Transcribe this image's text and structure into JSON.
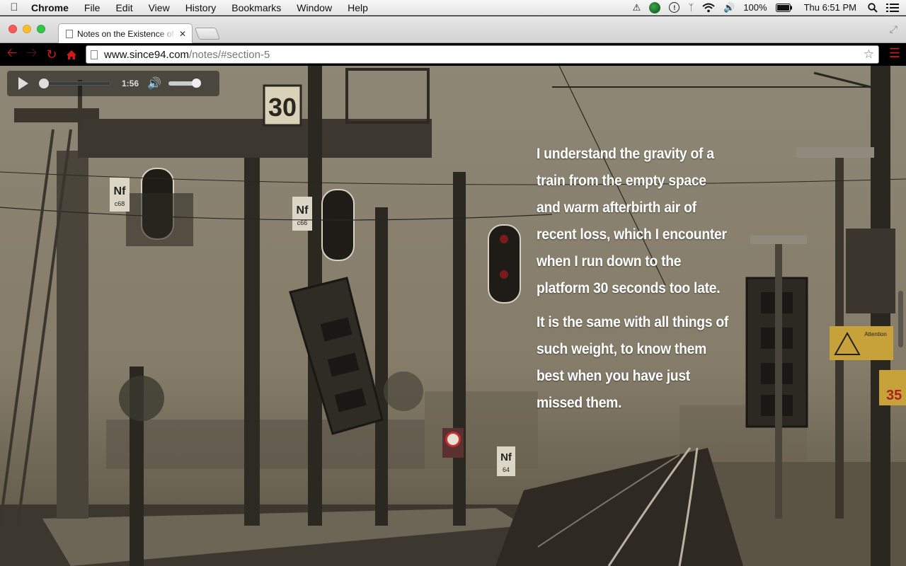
{
  "menubar": {
    "app_name": "Chrome",
    "menus": [
      "File",
      "Edit",
      "View",
      "History",
      "Bookmarks",
      "Window",
      "Help"
    ],
    "battery": "100%",
    "clock": "Thu 6:51 PM"
  },
  "tab": {
    "title": "Notes on the Existence of"
  },
  "omnibox": {
    "host": "www.since94.com",
    "path": "/notes/#section-5"
  },
  "audio": {
    "progress": 0,
    "time": "1:56",
    "volume": 1.0
  },
  "passage": {
    "paragraphs": [
      "I understand the gravity of a train from the empty space and warm afterbirth air of recent loss, which I encounter when I run down to the platform 30 seconds too late.",
      "It is the same with all things of such weight, to know them best when you have just missed them."
    ]
  },
  "scene": {
    "sign_speed": "30",
    "sign_nf1": "Nf",
    "sign_c68": "c68",
    "sign_c66": "c66",
    "sign_nf2": "Nf",
    "sign_64": "64",
    "sign_attention": "Attention",
    "sign_35": "35"
  },
  "colors": {
    "accent_red": "#d11a1a",
    "photo_tint": "#8c8472"
  }
}
